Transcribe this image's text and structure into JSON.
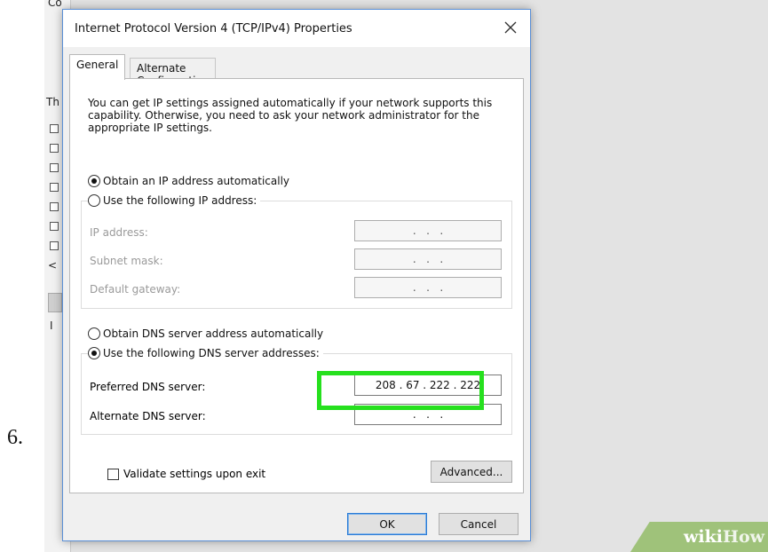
{
  "step_number": "6.",
  "background_window": {
    "text_top": "Co",
    "text_mid": "Th",
    "row_marker": "<",
    "text_low": "I"
  },
  "dialog": {
    "title": "Internet Protocol Version 4 (TCP/IPv4) Properties",
    "close_glyph": "✕",
    "tabs": [
      {
        "label": "General",
        "active": true
      },
      {
        "label": "Alternate Configuration",
        "active": false
      }
    ],
    "info_text": "You can get IP settings assigned automatically if your network supports this capability. Otherwise, you need to ask your network administrator for the appropriate IP settings.",
    "ip_section": {
      "auto_option": {
        "label": "Obtain an IP address automatically",
        "checked": true
      },
      "manual_option": {
        "label": "Use the following IP address:",
        "checked": false
      },
      "fields": [
        {
          "label": "IP address:",
          "value": ".   .   ."
        },
        {
          "label": "Subnet mask:",
          "value": ".   .   ."
        },
        {
          "label": "Default gateway:",
          "value": ".   .   ."
        }
      ]
    },
    "dns_section": {
      "auto_option": {
        "label": "Obtain DNS server address automatically",
        "checked": false
      },
      "manual_option": {
        "label": "Use the following DNS server addresses:",
        "checked": true
      },
      "preferred": {
        "label": "Preferred DNS server:",
        "value": "208 . 67 . 222 . 222"
      },
      "alternate": {
        "label": "Alternate DNS server:",
        "value": ".   .   ."
      }
    },
    "validate_checkbox": {
      "label": "Validate settings upon exit",
      "checked": false
    },
    "advanced_button": "Advanced...",
    "ok_button": "OK",
    "cancel_button": "Cancel"
  },
  "watermark": {
    "part1": "wiki",
    "part2": "How"
  },
  "colors": {
    "highlight": "#26e01e",
    "dialog_border": "#5a8fd6",
    "watermark_bg": "#9fc27a"
  }
}
